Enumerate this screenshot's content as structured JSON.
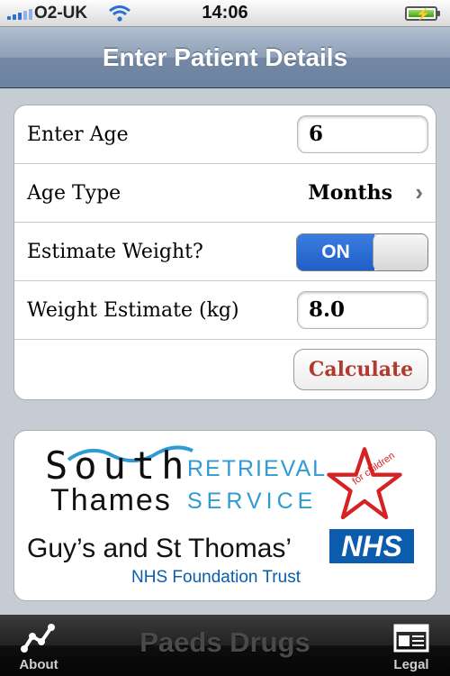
{
  "status_bar": {
    "carrier": "O2-UK",
    "time": "14:06",
    "icons": [
      "signal-bars-icon",
      "wifi-icon",
      "battery-charging-icon"
    ]
  },
  "nav": {
    "title": "Enter Patient Details"
  },
  "form": {
    "age_label": "Enter Age",
    "age_value": "6",
    "age_type_label": "Age Type",
    "age_type_value": "Months",
    "estimate_label": "Estimate Weight?",
    "estimate_state": "ON",
    "weight_label": "Weight Estimate (kg)",
    "weight_value": "8.0",
    "calculate_label": "Calculate"
  },
  "logos": {
    "south": "South",
    "thames": "Thames",
    "retrieval": "RETRIEVAL",
    "service": "SERVICE",
    "for_children": "for children",
    "guys": "Guy’s and St Thomas’",
    "nhs": "NHS",
    "trust": "NHS Foundation Trust"
  },
  "tabbar": {
    "app_name": "Paeds Drugs",
    "about_label": "About",
    "legal_label": "Legal",
    "about_icon": "graph-line-icon",
    "legal_icon": "newspaper-icon"
  },
  "colors": {
    "nav": "#7388a5",
    "switch_on": "#1f5fc8",
    "calculate_text": "#b13a2e",
    "retrieval_blue": "#2f9bd2",
    "nhs_blue": "#0b5cad"
  }
}
